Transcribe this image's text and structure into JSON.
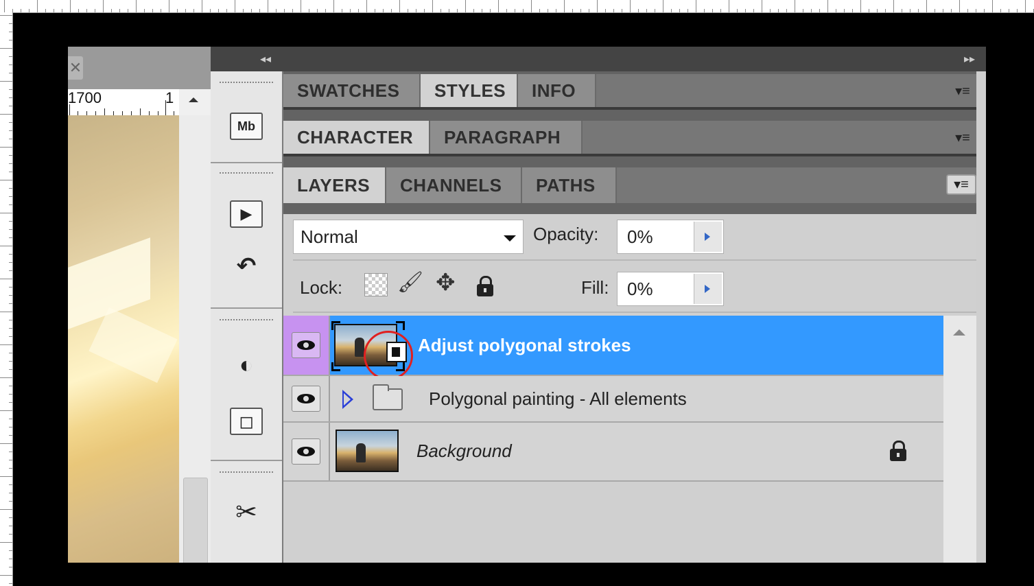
{
  "document": {
    "close_glyph": "✕",
    "ruler_labels": [
      "1700",
      "1"
    ]
  },
  "panel_collapse": {
    "left": "◂◂",
    "right": "▸▸"
  },
  "dock": {
    "buttons": [
      {
        "name": "mini-bridge-button",
        "glyph": "Mb"
      },
      {
        "name": "actions-button",
        "glyph": "▶"
      },
      {
        "name": "history-button",
        "glyph": "↶"
      },
      {
        "name": "adjustments-button",
        "glyph": "◐"
      },
      {
        "name": "masks-button",
        "glyph": "◻"
      },
      {
        "name": "tool-presets-button",
        "glyph": "✂"
      }
    ]
  },
  "tab_groups": [
    {
      "tabs": [
        "SWATCHES",
        "STYLES",
        "INFO"
      ],
      "active": "STYLES"
    },
    {
      "tabs": [
        "CHARACTER",
        "PARAGRAPH"
      ],
      "active": "CHARACTER"
    },
    {
      "tabs": [
        "LAYERS",
        "CHANNELS",
        "PATHS"
      ],
      "active": "LAYERS"
    }
  ],
  "panel_menu_glyph": "▾≡",
  "layers_panel": {
    "blend_mode": "Normal",
    "opacity_label": "Opacity:",
    "opacity_value": "0%",
    "lock_label": "Lock:",
    "fill_label": "Fill:",
    "fill_value": "0%",
    "layers": [
      {
        "name": "Adjust polygonal strokes",
        "selected": true,
        "type": "smart-object"
      },
      {
        "name": "Polygonal painting - All elements",
        "selected": false,
        "type": "group"
      },
      {
        "name": "Background",
        "selected": false,
        "type": "image",
        "locked": true
      }
    ]
  }
}
